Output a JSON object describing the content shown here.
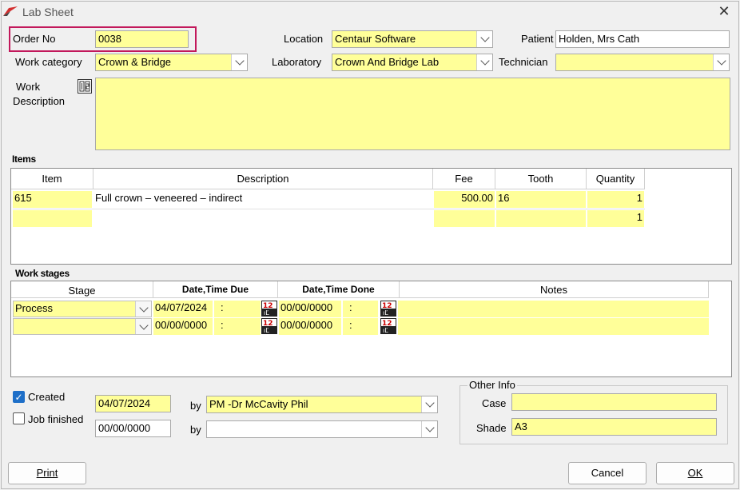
{
  "window": {
    "title": "Lab Sheet"
  },
  "fields": {
    "order_no_label": "Order No",
    "order_no": "0038",
    "location_label": "Location",
    "location": "Centaur Software",
    "patient_label": "Patient",
    "patient": "Holden, Mrs Cath",
    "work_category_label": "Work category",
    "work_category": "Crown & Bridge",
    "laboratory_label": "Laboratory",
    "laboratory": "Crown And Bridge Lab",
    "technician_label": "Technician",
    "technician": "",
    "work_description_label_1": "Work",
    "work_description_label_2": "Description",
    "work_description": ""
  },
  "items": {
    "section_label": "Items",
    "columns": [
      "Item",
      "Description",
      "Fee",
      "Tooth",
      "Quantity"
    ],
    "rows": [
      {
        "item": "615",
        "description": "Full crown – veneered – indirect",
        "fee": "500.00",
        "tooth": "16",
        "quantity": "1"
      },
      {
        "item": "",
        "description": "",
        "fee": "",
        "tooth": "",
        "quantity": "1"
      }
    ]
  },
  "work_stages": {
    "section_label": "Work stages",
    "columns": [
      "Stage",
      "Date,Time Due",
      "Date,Time Done",
      "Notes"
    ],
    "rows": [
      {
        "stage": "Process",
        "due_date": "04/07/2024",
        "due_time": ":",
        "done_date": "00/00/0000",
        "done_time": ":",
        "notes": ""
      },
      {
        "stage": "",
        "due_date": "00/00/0000",
        "due_time": ":",
        "done_date": "00/00/0000",
        "done_time": ":",
        "notes": ""
      }
    ]
  },
  "status": {
    "created_label": "Created",
    "created_checked": true,
    "created_date": "04/07/2024",
    "created_by_label": "by",
    "created_by": "PM -Dr McCavity Phil",
    "finished_label": "Job finished",
    "finished_checked": false,
    "finished_date": "00/00/0000",
    "finished_by_label": "by",
    "finished_by": ""
  },
  "other_info": {
    "group_label": "Other Info",
    "case_label": "Case",
    "case": "",
    "shade_label": "Shade",
    "shade": "A3"
  },
  "buttons": {
    "print": "Print",
    "cancel": "Cancel",
    "ok": "OK"
  },
  "colors": {
    "field_yellow": "#ffff99",
    "highlight": "#c2185b",
    "check_blue": "#1e6fc8"
  }
}
